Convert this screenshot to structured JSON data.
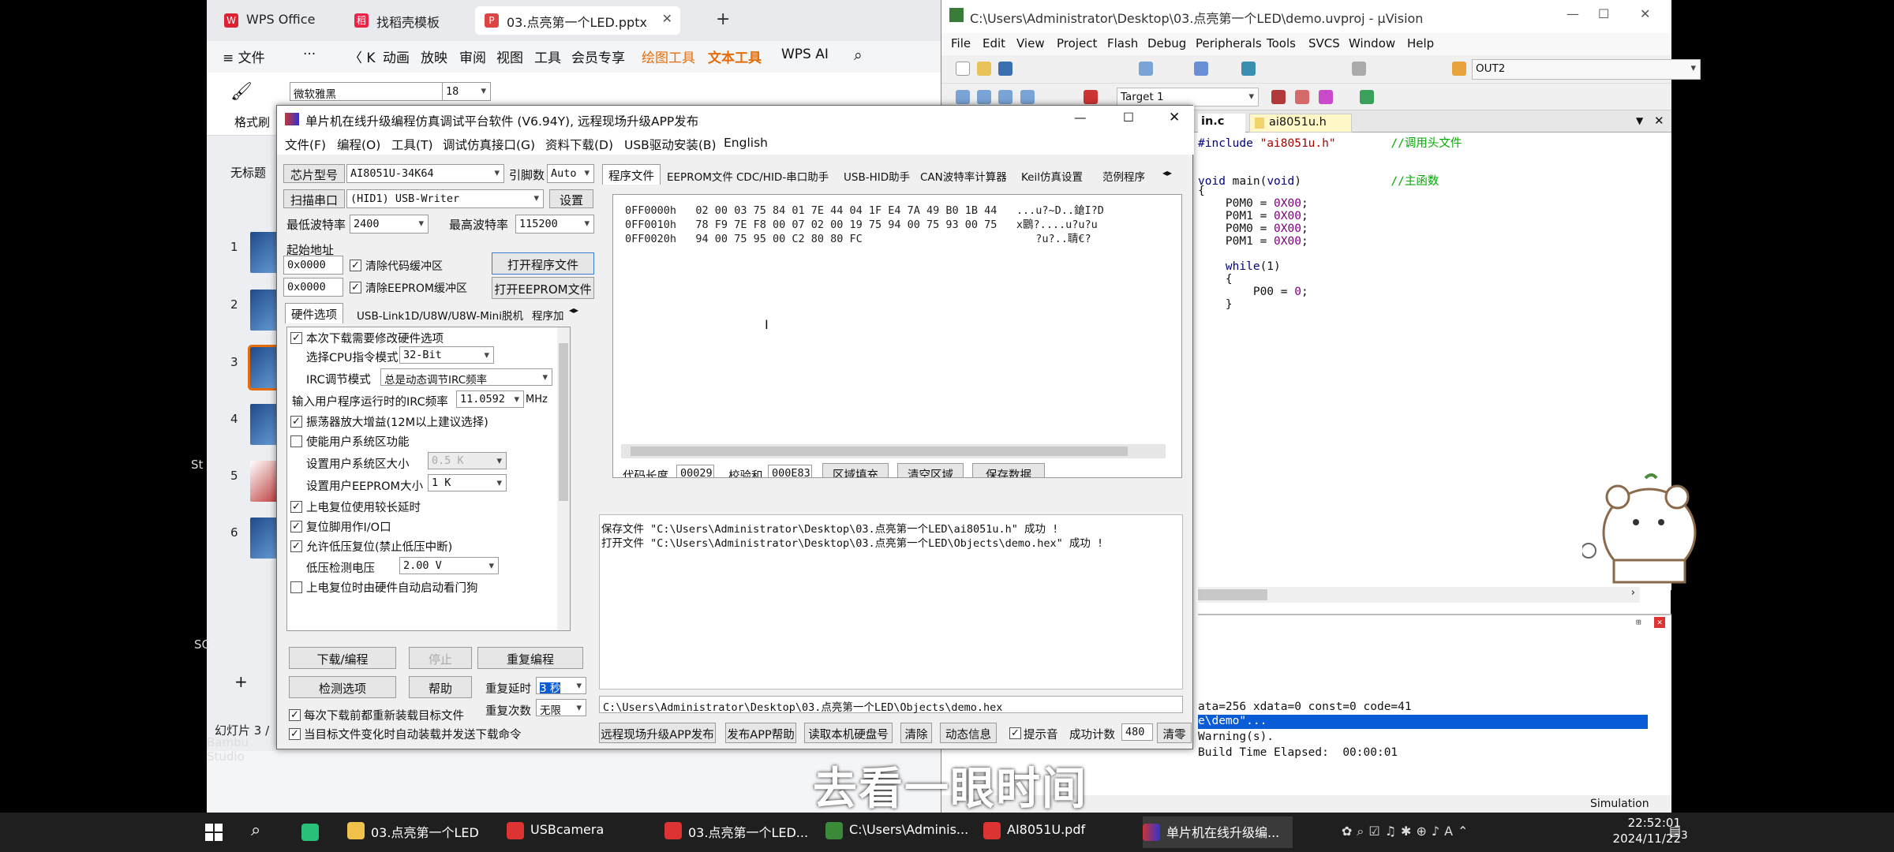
{
  "wps": {
    "tabs": [
      "WPS Office",
      "找稻壳模板",
      "03.点亮第一个LED.pptx"
    ],
    "menu": [
      "≡ 文件",
      "···",
      "〈 K",
      "动画",
      "放映",
      "审阅",
      "视图",
      "工具",
      "会员专享",
      "绘图工具",
      "文本工具",
      "WPS AI"
    ],
    "ribbon": {
      "format_brush": "格式刷",
      "font": "微软雅黑",
      "size": "18"
    },
    "slide_numbers": [
      "1",
      "2",
      "3",
      "4",
      "5",
      "6"
    ],
    "side_label": "无标题",
    "status": "幻灯片 3 /",
    "bg_labels": {
      "st": "St",
      "sc": "SC",
      "bambu": "Bambu",
      "studio": "Studio"
    }
  },
  "keil": {
    "title": "C:\\Users\\Administrator\\Desktop\\03.点亮第一个LED\\demo.uvproj - µVision",
    "menu": [
      "File",
      "Edit",
      "View",
      "Project",
      "Flash",
      "Debug",
      "Peripherals",
      "Tools",
      "SVCS",
      "Window",
      "Help"
    ],
    "toolbar_combo": "OUT2",
    "target": "Target 1",
    "tabs": [
      "in.c",
      "ai8051u.h"
    ],
    "code": [
      "#include \"ai8051u.h\"        //调用头文件",
      "",
      "void main(void)             //主函数",
      "{",
      "    P0M0 = 0X00;",
      "    P0M1 = 0X00;",
      "    P0M0 = 0X00;",
      "    P0M1 = 0X00;",
      "",
      "    while(1)",
      "    {",
      "        P00 = 0;",
      "    }"
    ],
    "build": [
      "ata=256 xdata=0 const=0 code=41",
      "e\\demo\"...",
      "Warning(s).",
      "Build Time Elapsed:  00:00:01"
    ],
    "status": "Simulation"
  },
  "stc": {
    "title": "单片机在线升级编程仿真调试平台软件 (V6.94Y), 远程现场升级APP发布",
    "menu": [
      "文件(F)",
      "编程(O)",
      "工具(T)",
      "调试仿真接口(G)",
      "资料下载(D)",
      "USB驱动安装(B)",
      "English"
    ],
    "chip_label": "芯片型号",
    "chip": "AI8051U-34K64",
    "pins_label": "引脚数",
    "pins": "Auto",
    "scan_label": "扫描串口",
    "port": "(HID1) USB-Writer",
    "settings": "设置",
    "min_baud_label": "最低波特率",
    "min_baud": "2400",
    "max_baud_label": "最高波特率",
    "max_baud": "115200",
    "start_addr": "起始地址",
    "addr1": "0x0000",
    "clear_code": "清除代码缓冲区",
    "open_prog": "打开程序文件",
    "addr2": "0x0000",
    "clear_eeprom": "清除EEPROM缓冲区",
    "open_eeprom": "打开EEPROM文件",
    "left_tabs": [
      "硬件选项",
      "USB-Link1D/U8W/U8W-Mini脱机",
      "程序加"
    ],
    "hw": {
      "opt1": "本次下载需要修改硬件选项",
      "cpu_label": "选择CPU指令模式",
      "cpu": "32-Bit",
      "irc_label": "IRC调节模式",
      "irc": "总是动态调节IRC频率",
      "freq_label": "输入用户程序运行时的IRC频率",
      "freq": "11.0592",
      "freq_unit": "MHz",
      "opt2": "振荡器放大增益(12M以上建议选择)",
      "opt3": "使能用户系统区功能",
      "sys_size_label": "设置用户系统区大小",
      "sys_size": "0.5 K",
      "eeprom_label": "设置用户EEPROM大小",
      "eeprom_size": "1  K",
      "opt4": "上电复位使用较长延时",
      "opt5": "复位脚用作I/O口",
      "opt6": "允许低压复位(禁止低压中断)",
      "lv_label": "低压检测电压",
      "lv": "2.00 V",
      "opt7": "上电复位时由硬件自动启动看门狗"
    },
    "right_tabs": [
      "程序文件",
      "EEPROM文件",
      "CDC/HID-串口助手",
      "USB-HID助手",
      "CAN波特率计算器",
      "Keil仿真设置",
      "范例程序"
    ],
    "hex_rows": [
      {
        "addr": "0FF0000h",
        "bytes": "02 00 03 75 84 01 7E 44 04 1F E4 7A 49 B0 1B 44",
        "ascii": "...u?~D..鎗I?D"
      },
      {
        "addr": "0FF0010h",
        "bytes": "78 F9 7E F8 00 07 02 00 19 75 94 00 75 93 00 75",
        "ascii": "x鶠?....u?u?u"
      },
      {
        "addr": "0FF0020h",
        "bytes": "94 00 75 95 00 C2 80 80 FC",
        "ascii": "?u?..聙€?"
      }
    ],
    "code_len_label": "代码长度",
    "code_len": "00029",
    "checksum_label": "校验和",
    "checksum": "000E83",
    "hex_buttons": [
      "区域填充",
      "清空区域",
      "保存数据"
    ],
    "log": [
      "保存文件 \"C:\\Users\\Administrator\\Desktop\\03.点亮第一个LED\\ai8051u.h\" 成功 !",
      "打开文件 \"C:\\Users\\Administrator\\Desktop\\03.点亮第一个LED\\Objects\\demo.hex\" 成功 !"
    ],
    "path": "C:\\Users\\Administrator\\Desktop\\03.点亮第一个LED\\Objects\\demo.hex",
    "download": "下载/编程",
    "stop": "停止",
    "reprogram": "重复编程",
    "check": "检测选项",
    "help": "帮助",
    "delay_label": "重复延时",
    "delay": "3 秒",
    "times_label": "重复次数",
    "times": "无限",
    "opt_reload": "每次下载前都重新装载目标文件",
    "opt_auto": "当目标文件变化时自动装载并发送下载命令",
    "bottom_buttons": [
      "远程现场升级APP发布",
      "发布APP帮助",
      "读取本机硬盘号",
      "清除",
      "动态信息"
    ],
    "hint": "提示音",
    "success_label": "成功计数",
    "success": "480",
    "clear": "清零"
  },
  "taskbar": {
    "items": [
      "03.点亮第一个LED",
      "USBcamera",
      "03.点亮第一个LED...",
      "C:\\Users\\Adminis...",
      "AI8051U.pdf",
      "单片机在线升级编..."
    ],
    "time": "22:52:01",
    "date": "2024/11/22",
    "notif": "3"
  },
  "caption": "去看一眼时间"
}
